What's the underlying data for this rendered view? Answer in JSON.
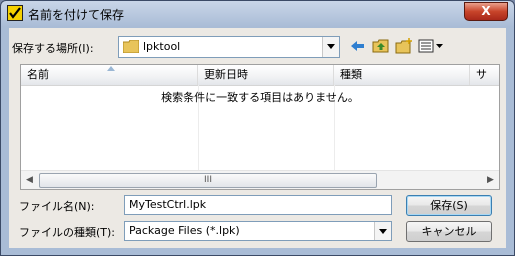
{
  "window": {
    "title": "名前を付けて保存",
    "close_glyph": "X",
    "app_icon": "checkmark-app-icon"
  },
  "location": {
    "label": "保存する場所(I):",
    "value": "lpktool",
    "icon": "folder-icon"
  },
  "toolbar": {
    "icons": [
      "back-arrow-icon",
      "up-folder-icon",
      "new-folder-icon",
      "view-menu-icon"
    ]
  },
  "file_list": {
    "columns": [
      "名前",
      "更新日時",
      "種類",
      "サ"
    ],
    "empty_message": "検索条件に一致する項目はありません。",
    "scroll_left": "◀",
    "scroll_right": "▶",
    "thumb_grip": "III"
  },
  "filename": {
    "label": "ファイル名(N):",
    "value": "MyTestCtrl.lpk"
  },
  "filetype": {
    "label": "ファイルの種類(T):",
    "value": "Package Files (*.lpk)"
  },
  "buttons": {
    "save": "保存(S)",
    "cancel": "キャンセル"
  },
  "colors": {
    "accent": "#3c7fb1",
    "close": "#c8442a"
  }
}
